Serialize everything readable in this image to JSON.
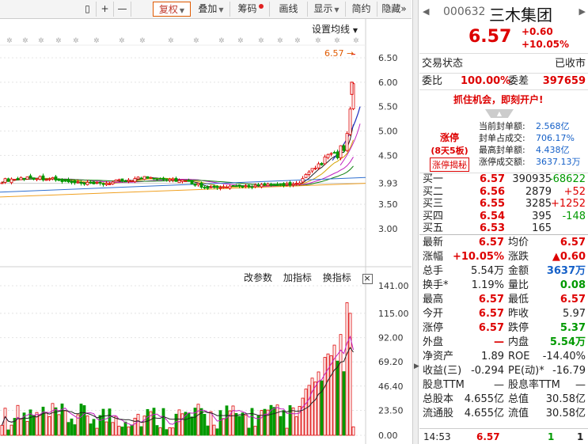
{
  "toolbar": {
    "add": "+",
    "minus": "—",
    "fuquan": "复权",
    "diejia": "叠加",
    "chouma": "筹码",
    "huaxian": "画线",
    "xianshi": "显示",
    "jianyue": "简约",
    "yincang": "隐藏",
    "more": "»"
  },
  "kline": {
    "ma_setting": "设置均线",
    "price_flag": "6.57",
    "current_label": "3.93",
    "y_ticks": [
      "6.50",
      "6.00",
      "5.50",
      "5.00",
      "4.50",
      "3.93",
      "3.50",
      "3.00"
    ],
    "y_values": [
      6.5,
      6.0,
      5.5,
      5.0,
      4.5,
      3.93,
      3.5,
      3.0
    ]
  },
  "volume": {
    "buttons": {
      "params": "改参数",
      "add": "加指标",
      "switch": "换指标",
      "close": "×"
    },
    "y_ticks": [
      "141.00",
      "115.00",
      "92.00",
      "69.20",
      "46.40",
      "23.50",
      "0.00"
    ],
    "y_values": [
      141,
      115,
      92,
      69.2,
      46.4,
      23.5,
      0
    ]
  },
  "header": {
    "code": "000632",
    "name": "三木集团",
    "price": "6.57",
    "change": "+0.60",
    "change_pct": "+10.05%"
  },
  "status": {
    "label": "交易状态",
    "value": "已收市"
  },
  "ratio": {
    "wb_label": "委比",
    "wb_value": "100.00%",
    "wc_label": "委差",
    "wc_value": "397659"
  },
  "promo": "抓住机会，即刻开户!",
  "limit": {
    "title": "涨停",
    "sub": "(8天5板)",
    "btn": "涨停揭秘",
    "rows": [
      {
        "label": "当前封单额:",
        "value": "2.568亿"
      },
      {
        "label": "封单占成交:",
        "value": "706.17%"
      },
      {
        "label": "最高封单额:",
        "value": "4.438亿"
      },
      {
        "label": "涨停成交额:",
        "value": "3637.13万"
      }
    ]
  },
  "bids": [
    {
      "label": "买一",
      "price": "6.57",
      "vol": "390935",
      "chg": "-68622",
      "chg_color": "green"
    },
    {
      "label": "买二",
      "price": "6.56",
      "vol": "2879",
      "chg": "+52",
      "chg_color": "red"
    },
    {
      "label": "买三",
      "price": "6.55",
      "vol": "3285",
      "chg": "+1252",
      "chg_color": "red"
    },
    {
      "label": "买四",
      "price": "6.54",
      "vol": "395",
      "chg": "-148",
      "chg_color": "green"
    },
    {
      "label": "买五",
      "price": "6.53",
      "vol": "165",
      "chg": "",
      "chg_color": "red"
    }
  ],
  "quotes": [
    {
      "l1": "最新",
      "v1": "6.57",
      "c1": "red",
      "l2": "均价",
      "v2": "6.57",
      "c2": "red"
    },
    {
      "l1": "涨幅",
      "v1": "+10.05%",
      "c1": "red",
      "l2": "涨跌",
      "v2": "▲0.60",
      "c2": "red"
    },
    {
      "l1": "总手",
      "v1": "5.54万",
      "c1": "black",
      "l2": "金额",
      "v2": "3637万",
      "c2": "blue"
    },
    {
      "l1": "换手*",
      "v1": "1.19%",
      "c1": "black",
      "l2": "量比",
      "v2": "0.08",
      "c2": "green"
    },
    {
      "l1": "最高",
      "v1": "6.57",
      "c1": "red",
      "l2": "最低",
      "v2": "6.57",
      "c2": "red"
    },
    {
      "l1": "今开",
      "v1": "6.57",
      "c1": "red",
      "l2": "昨收",
      "v2": "5.97",
      "c2": "black"
    },
    {
      "l1": "涨停",
      "v1": "6.57",
      "c1": "red",
      "l2": "跌停",
      "v2": "5.37",
      "c2": "green"
    },
    {
      "l1": "外盘",
      "v1": "—",
      "c1": "red",
      "l2": "内盘",
      "v2": "5.54万",
      "c2": "green"
    },
    {
      "l1": "净资产",
      "v1": "1.89",
      "c1": "black",
      "l2": "ROE",
      "v2": "-14.40%",
      "c2": "black"
    },
    {
      "l1": "收益(三)",
      "v1": "-0.294",
      "c1": "black",
      "l2": "PE(动)*",
      "v2": "-16.79",
      "c2": "black"
    },
    {
      "l1": "股息TTM",
      "v1": "—",
      "c1": "black",
      "l2": "股息率TTM",
      "v2": "—",
      "c2": "black"
    },
    {
      "l1": "总股本",
      "v1": "4.655亿",
      "c1": "black",
      "l2": "总值",
      "v2": "30.58亿",
      "c2": "black"
    },
    {
      "l1": "流通股",
      "v1": "4.655亿",
      "c1": "black",
      "l2": "流值",
      "v2": "30.58亿",
      "c2": "black"
    }
  ],
  "tick": {
    "time": "14:53",
    "price": "6.57",
    "vol": "1",
    "count": "1"
  },
  "colors": {
    "up": "#dd0000",
    "down": "#009900",
    "accent": "#e05a00"
  }
}
